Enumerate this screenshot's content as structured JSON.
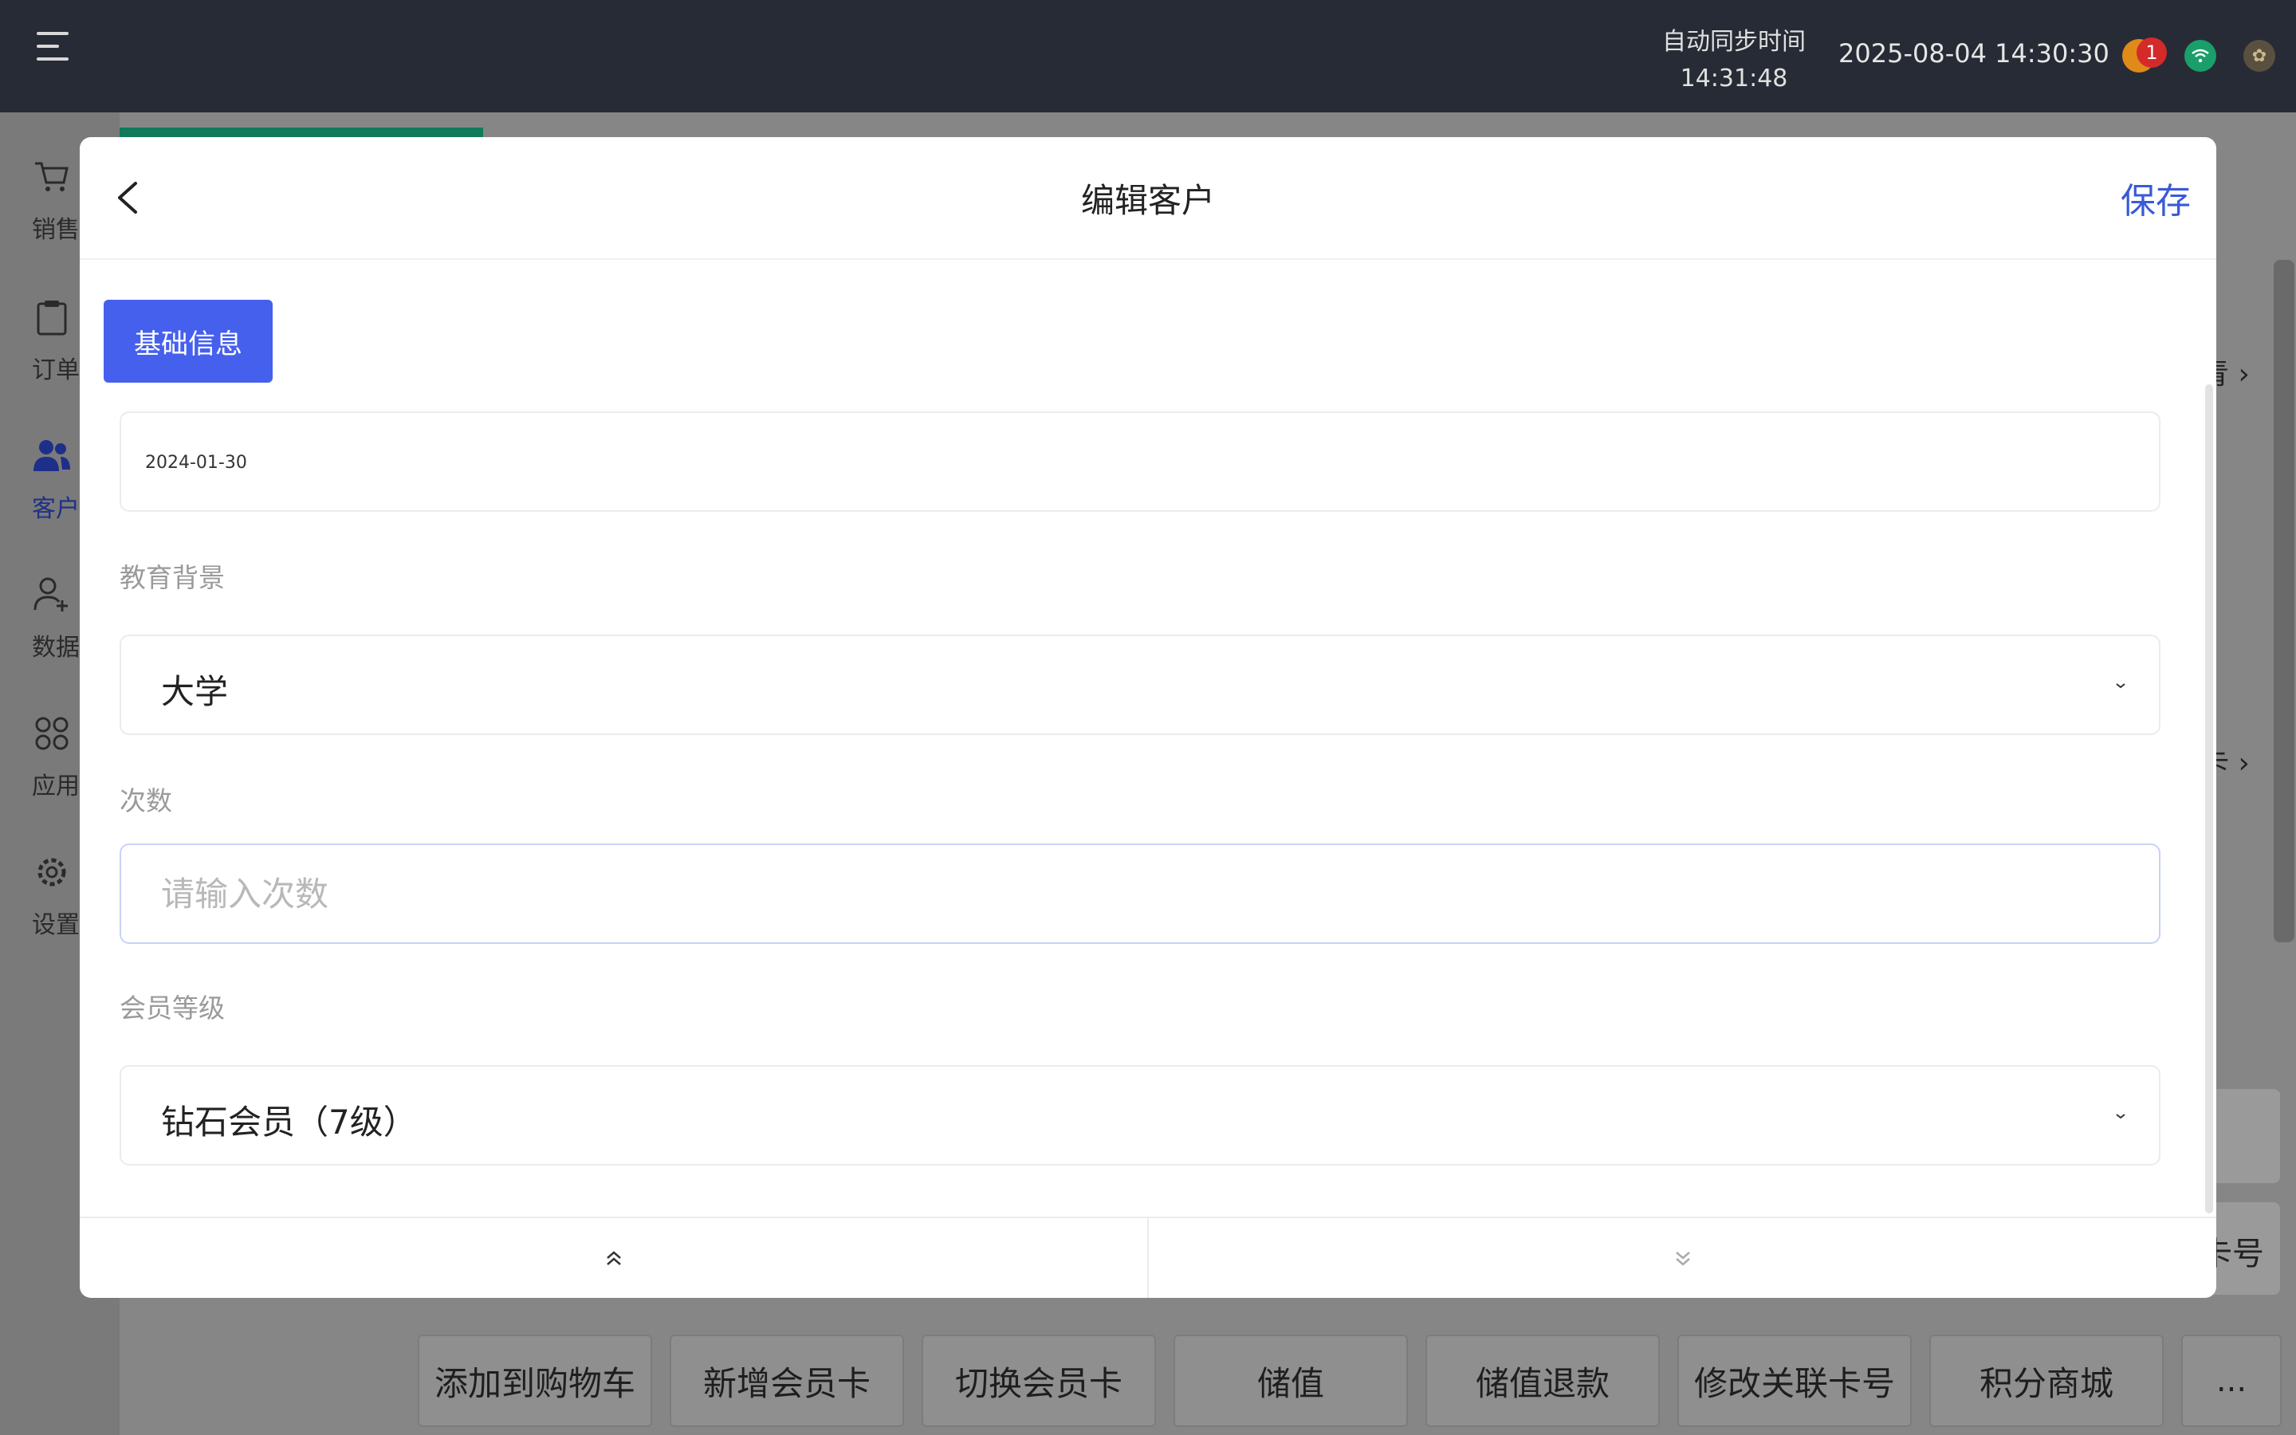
{
  "topbar": {
    "sync_label": "自动同步时间",
    "sync_time": "14:31:48",
    "datetime": "2025-08-04 14:30:30",
    "notification_count": "1",
    "avatar_glyph": "✿"
  },
  "sidebar": {
    "items": [
      {
        "label": "销售",
        "icon": "cart-icon"
      },
      {
        "label": "订单",
        "icon": "clipboard-icon"
      },
      {
        "label": "客户",
        "icon": "users-icon"
      },
      {
        "label": "数据",
        "icon": "user-add-icon"
      },
      {
        "label": "应用",
        "icon": "apps-icon"
      },
      {
        "label": "设置",
        "icon": "gear-icon"
      }
    ]
  },
  "background": {
    "peek_1": "青 ›",
    "peek_2": "卡 ›",
    "peek_3": "卡号"
  },
  "actions": {
    "items": [
      "添加到购物车",
      "新增会员卡",
      "切换会员卡",
      "储值",
      "储值退款",
      "修改关联卡号",
      "积分商城"
    ],
    "more": "..."
  },
  "modal": {
    "title": "编辑客户",
    "save_label": "保存",
    "section_tab": "基础信息",
    "date_value": "2024-01-30",
    "education": {
      "label": "教育背景",
      "value": "大学"
    },
    "count": {
      "label": "次数",
      "placeholder": "请输入次数"
    },
    "member_level": {
      "label": "会员等级",
      "value": "钻石会员（7级）"
    }
  },
  "colors": {
    "topbar": "#272b35",
    "accent": "#4660ee",
    "save": "#3a5ad8",
    "active_tab": "#117a5a"
  }
}
